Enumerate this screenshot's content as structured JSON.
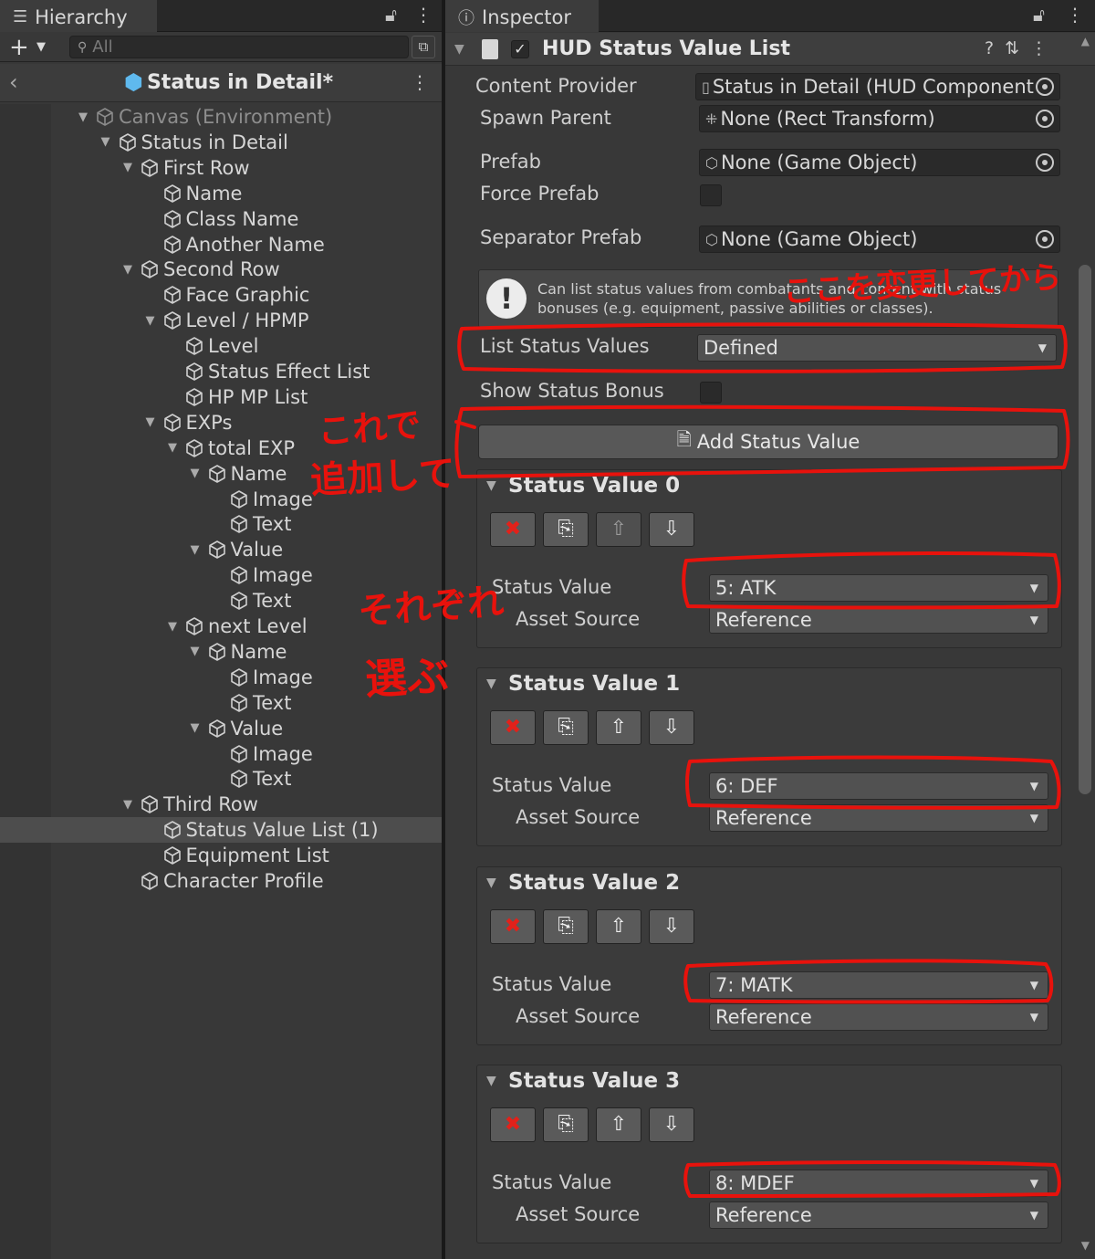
{
  "hierarchy": {
    "tab_label": "Hierarchy",
    "search_placeholder": "All",
    "scene_title": "Status in Detail*",
    "tree": [
      {
        "label": "Canvas (Environment)",
        "depth": 0,
        "fold": true,
        "dim": true
      },
      {
        "label": "Status in Detail",
        "depth": 1,
        "fold": true
      },
      {
        "label": "First Row",
        "depth": 2,
        "fold": true
      },
      {
        "label": "Name",
        "depth": 3,
        "fold": false
      },
      {
        "label": "Class Name",
        "depth": 3,
        "fold": false
      },
      {
        "label": "Another Name",
        "depth": 3,
        "fold": false
      },
      {
        "label": "Second Row",
        "depth": 2,
        "fold": true
      },
      {
        "label": "Face Graphic",
        "depth": 3,
        "fold": false
      },
      {
        "label": "Level / HPMP",
        "depth": 3,
        "fold": true
      },
      {
        "label": "Level",
        "depth": 4,
        "fold": false
      },
      {
        "label": "Status Effect List",
        "depth": 4,
        "fold": false
      },
      {
        "label": "HP MP List",
        "depth": 4,
        "fold": false
      },
      {
        "label": "EXPs",
        "depth": 3,
        "fold": true
      },
      {
        "label": "total EXP",
        "depth": 4,
        "fold": true
      },
      {
        "label": "Name",
        "depth": 5,
        "fold": true
      },
      {
        "label": "Image",
        "depth": 6,
        "fold": false
      },
      {
        "label": "Text",
        "depth": 6,
        "fold": false
      },
      {
        "label": "Value",
        "depth": 5,
        "fold": true
      },
      {
        "label": "Image",
        "depth": 6,
        "fold": false
      },
      {
        "label": "Text",
        "depth": 6,
        "fold": false
      },
      {
        "label": "next Level",
        "depth": 4,
        "fold": true
      },
      {
        "label": "Name",
        "depth": 5,
        "fold": true
      },
      {
        "label": "Image",
        "depth": 6,
        "fold": false
      },
      {
        "label": "Text",
        "depth": 6,
        "fold": false
      },
      {
        "label": "Value",
        "depth": 5,
        "fold": true
      },
      {
        "label": "Image",
        "depth": 6,
        "fold": false
      },
      {
        "label": "Text",
        "depth": 6,
        "fold": false
      },
      {
        "label": "Third Row",
        "depth": 2,
        "fold": true
      },
      {
        "label": "Status Value List (1)",
        "depth": 3,
        "fold": false,
        "selected": true
      },
      {
        "label": "Equipment List",
        "depth": 3,
        "fold": false
      },
      {
        "label": "Character Profile",
        "depth": 2,
        "fold": false
      }
    ]
  },
  "inspector": {
    "tab_label": "Inspector",
    "component_title": "HUD Status Value List",
    "fields": {
      "content_provider_label": "Content Provider",
      "content_provider_value": "Status in Detail (HUD Component",
      "spawn_parent_label": "Spawn Parent",
      "spawn_parent_value": "None (Rect Transform)",
      "prefab_label": "Prefab",
      "prefab_value": "None (Game Object)",
      "force_prefab_label": "Force Prefab",
      "separator_prefab_label": "Separator Prefab",
      "separator_prefab_value": "None (Game Object)",
      "help_text": "Can list status values from combatants and content with status bonuses (e.g. equipment, passive abilities or classes).",
      "list_status_values_label": "List Status Values",
      "list_status_values_value": "Defined",
      "show_status_bonus_label": "Show Status Bonus",
      "add_button_label": "Add Status Value"
    },
    "status_values": [
      {
        "title": "Status Value 0",
        "status_label": "Status Value",
        "status_value": "5: ATK",
        "asset_label": "Asset Source",
        "asset_value": "Reference",
        "up_enabled": false
      },
      {
        "title": "Status Value 1",
        "status_label": "Status Value",
        "status_value": "6: DEF",
        "asset_label": "Asset Source",
        "asset_value": "Reference",
        "up_enabled": true
      },
      {
        "title": "Status Value 2",
        "status_label": "Status Value",
        "status_value": "7: MATK",
        "asset_label": "Asset Source",
        "asset_value": "Reference",
        "up_enabled": true
      },
      {
        "title": "Status Value 3",
        "status_label": "Status Value",
        "status_value": "8: MDEF",
        "asset_label": "Asset Source",
        "asset_value": "Reference",
        "up_enabled": true
      }
    ]
  },
  "annotations": {
    "note_change_here": "ここを変更してから",
    "note_add_with_this": "これで",
    "note_add_with_this_2": "追加して",
    "note_choose": "それぞれ",
    "note_choose_2": "選ぶ",
    "color": "#e8120c"
  }
}
